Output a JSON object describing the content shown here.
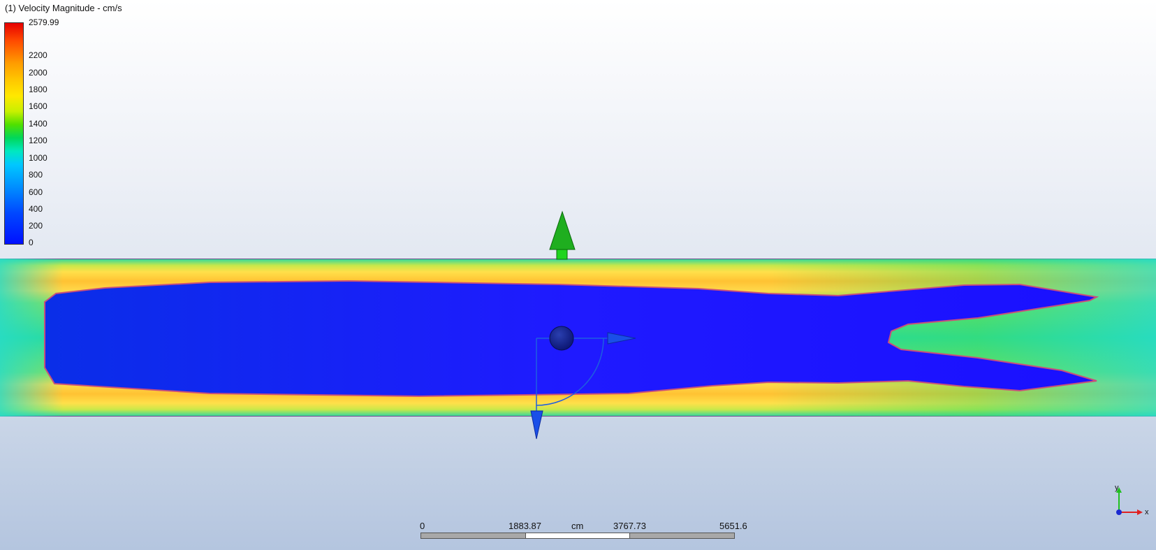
{
  "legend": {
    "title": "(1) Velocity Magnitude - cm/s",
    "max_label": "2579.99",
    "ticks": [
      "2200",
      "2000",
      "1800",
      "1600",
      "1400",
      "1200",
      "1000",
      "800",
      "600",
      "400",
      "200",
      "0"
    ]
  },
  "scale_bar": {
    "labels": [
      "0",
      "1883.87",
      "3767.73",
      "5651.6"
    ],
    "unit": "cm"
  },
  "triad": {
    "x_label": "x",
    "y_label": "y"
  }
}
